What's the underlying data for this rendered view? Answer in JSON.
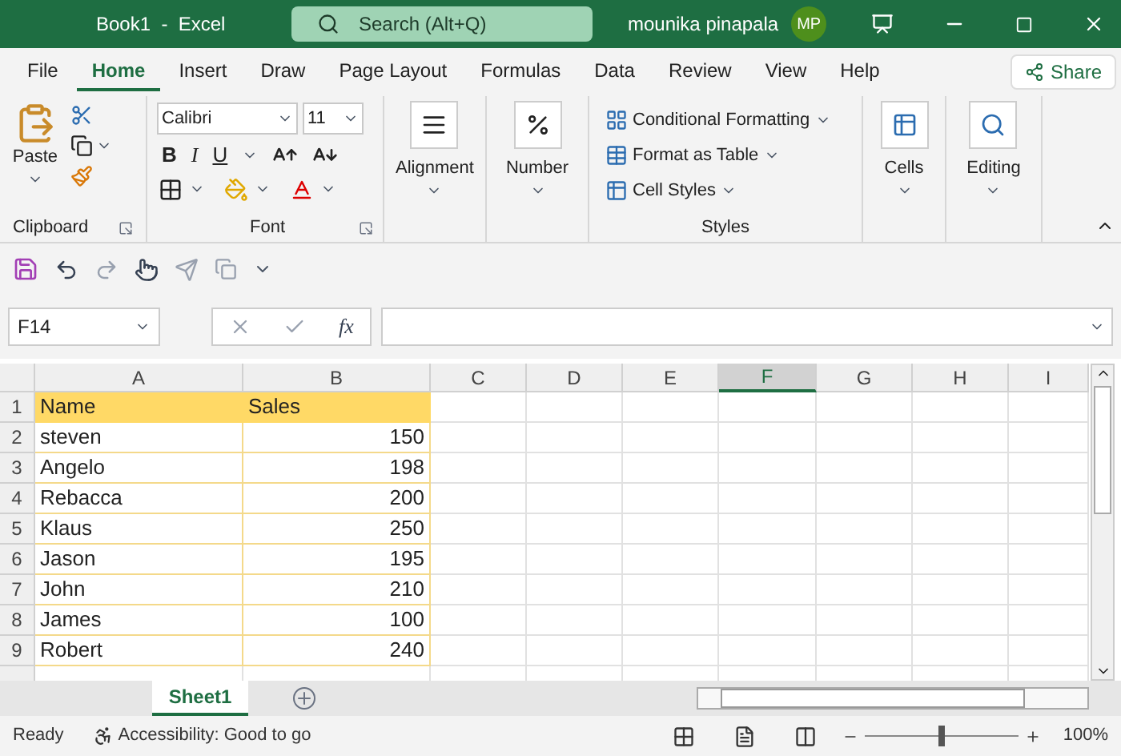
{
  "window": {
    "title": "Book1  -  Excel",
    "search_placeholder": "Search (Alt+Q)",
    "user": "mounika pinapala",
    "avatar": "MP"
  },
  "tabs": [
    {
      "label": "File",
      "selected": false
    },
    {
      "label": "Home",
      "selected": true
    },
    {
      "label": "Insert",
      "selected": false
    },
    {
      "label": "Draw",
      "selected": false
    },
    {
      "label": "Page Layout",
      "selected": false
    },
    {
      "label": "Formulas",
      "selected": false
    },
    {
      "label": "Data",
      "selected": false
    },
    {
      "label": "Review",
      "selected": false
    },
    {
      "label": "View",
      "selected": false
    },
    {
      "label": "Help",
      "selected": false
    }
  ],
  "share": "Share",
  "ribbon": {
    "clipboard": {
      "label": "Clipboard",
      "paste": "Paste"
    },
    "font": {
      "label": "Font",
      "name": "Calibri",
      "size": "11",
      "bold": "B",
      "italic": "I",
      "underline": "U"
    },
    "alignment": "Alignment",
    "number": "Number",
    "styles": {
      "label": "Styles",
      "items": [
        "Conditional Formatting",
        "Format as Table",
        "Cell Styles"
      ]
    },
    "cells": "Cells",
    "editing": "Editing"
  },
  "formula_bar": {
    "name_box": "F14",
    "fx": "fx"
  },
  "columns": [
    {
      "label": "A",
      "selected": false
    },
    {
      "label": "B",
      "selected": false
    },
    {
      "label": "C",
      "selected": false
    },
    {
      "label": "D",
      "selected": false
    },
    {
      "label": "E",
      "selected": false
    },
    {
      "label": "F",
      "selected": true
    },
    {
      "label": "G",
      "selected": false
    },
    {
      "label": "H",
      "selected": false
    },
    {
      "label": "I",
      "selected": false
    }
  ],
  "rows": [
    {
      "number": "1",
      "kind": "header",
      "cells": [
        "Name",
        "Sales"
      ]
    },
    {
      "number": "2",
      "kind": "data",
      "cells": [
        "steven",
        "150"
      ]
    },
    {
      "number": "3",
      "kind": "data",
      "cells": [
        "Angelo",
        "198"
      ]
    },
    {
      "number": "4",
      "kind": "data",
      "cells": [
        "Rebacca",
        "200"
      ]
    },
    {
      "number": "5",
      "kind": "data",
      "cells": [
        "Klaus",
        "250"
      ]
    },
    {
      "number": "6",
      "kind": "data",
      "cells": [
        "Jason",
        "195"
      ]
    },
    {
      "number": "7",
      "kind": "data",
      "cells": [
        "John",
        "210"
      ]
    },
    {
      "number": "8",
      "kind": "data",
      "cells": [
        "James",
        "100"
      ]
    },
    {
      "number": "9",
      "kind": "data",
      "cells": [
        "Robert",
        "240"
      ]
    }
  ],
  "sheets": [
    {
      "label": "Sheet1",
      "selected": true
    }
  ],
  "status_bar": {
    "state": "Ready",
    "accessibility": "Accessibility: Good to go",
    "zoom": "100%",
    "zoom_level": {
      "level": 0.5
    }
  }
}
